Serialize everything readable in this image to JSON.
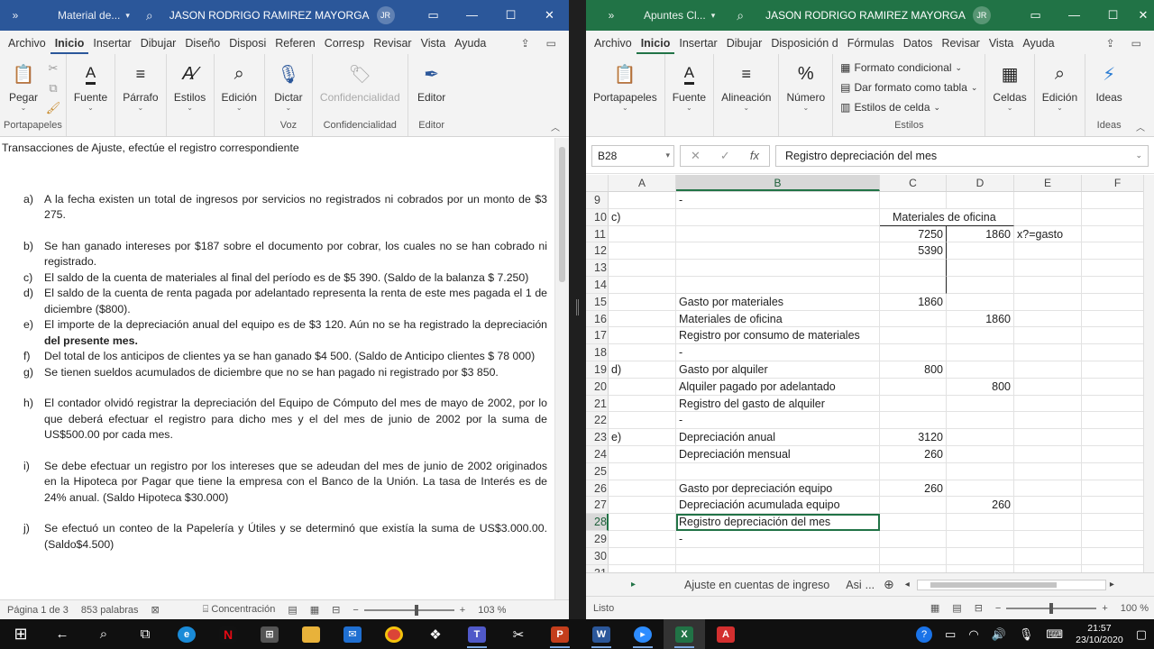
{
  "word": {
    "title_doc": "Material de...",
    "user": "JASON RODRIGO RAMIREZ MAYORGA",
    "initials": "JR",
    "tabs": [
      "Archivo",
      "Inicio",
      "Insertar",
      "Dibujar",
      "Diseño",
      "Disposi",
      "Referen",
      "Corresp",
      "Revisar",
      "Vista",
      "Ayuda"
    ],
    "ribbon": {
      "clipboard_group": "Portapapeles",
      "paste": "Pegar",
      "font": "Fuente",
      "paragraph": "Párrafo",
      "styles": "Estilos",
      "editing": "Edición",
      "dictate": "Dictar",
      "voice_group": "Voz",
      "confidentiality": "Confidencialidad",
      "confidentiality_group": "Confidencialidad",
      "editor": "Editor",
      "editor_group": "Editor"
    },
    "doc": {
      "heading": "Transacciones de Ajuste, efectúe el registro correspondiente",
      "items": [
        {
          "letter": "a)",
          "text": "A la fecha existen un total de ingresos por servicios no registrados ni cobrados por un monto de $3 275."
        },
        {
          "letter": "b)",
          "text": "Se han ganado intereses por $187 sobre el documento por cobrar, los cuales no se han cobrado ni registrado."
        },
        {
          "letter": "c)",
          "text": "El saldo de la cuenta de materiales al final del período es de $5 390. (Saldo de la balanza $ 7.250)"
        },
        {
          "letter": "d)",
          "text": "El saldo de la cuenta de renta pagada por adelantado representa la renta de este mes pagada el 1 de diciembre ($800)."
        },
        {
          "letter": "e)",
          "text_pre": "El importe de la depreciación anual del equipo es de $3 120. Aún no se ha registrado la depreciación ",
          "text_bold": "del presente mes."
        },
        {
          "letter": "f)",
          "text": "Del total de los anticipos de clientes ya se han ganado $4 500. (Saldo de Anticipo clientes $ 78 000)"
        },
        {
          "letter": "g)",
          "text": "Se tienen sueldos acumulados de diciembre que no se han pagado ni registrado por $3 850."
        },
        {
          "letter": "h)",
          "text": "El contador olvidó registrar la depreciación del Equipo de Cómputo del mes de mayo de 2002, por lo que deberá efectuar el registro para dicho mes y el del mes de junio de 2002 por la suma de US$500.00 por cada mes."
        },
        {
          "letter": "i)",
          "text": "Se debe efectuar un registro por los intereses que se adeudan del mes de junio de 2002 originados en la Hipoteca por Pagar que tiene la empresa con el Banco de la Unión. La tasa de Interés es de 24% anual. (Saldo Hipoteca $30.000)"
        },
        {
          "letter": "j)",
          "text": "Se efectuó un conteo de la Papelería y Útiles y se determinó que existía la suma de US$3.000.00. (Saldo$4.500)"
        }
      ]
    },
    "status": {
      "page": "Página 1 de 3",
      "words": "853 palabras",
      "focus": "Concentración",
      "zoom": "103 %"
    }
  },
  "excel": {
    "title_doc": "Apuntes Cl...",
    "user": "JASON RODRIGO RAMIREZ MAYORGA",
    "initials": "JR",
    "tabs": [
      "Archivo",
      "Inicio",
      "Insertar",
      "Dibujar",
      "Disposición d",
      "Fórmulas",
      "Datos",
      "Revisar",
      "Vista",
      "Ayuda"
    ],
    "ribbon": {
      "clipboard": "Portapapeles",
      "font": "Fuente",
      "alignment": "Alineación",
      "number": "Número",
      "conditional": "Formato condicional",
      "table_format": "Dar formato como tabla",
      "cell_styles": "Estilos de celda",
      "styles_group": "Estilos",
      "cells": "Celdas",
      "editing": "Edición",
      "ideas": "Ideas",
      "ideas_group": "Ideas"
    },
    "namebox": "B28",
    "formula": "Registro depreciación del mes",
    "columns": [
      "A",
      "B",
      "C",
      "D",
      "E",
      "F"
    ],
    "rows": [
      {
        "n": "9",
        "a": "",
        "b": "-",
        "c": "",
        "d": "",
        "e": ""
      },
      {
        "n": "10",
        "a": "c)",
        "b": "",
        "c": "Materiales de oficina",
        "d": "",
        "e": ""
      },
      {
        "n": "11",
        "a": "",
        "b": "",
        "c": "7250",
        "d": "1860",
        "e": "x?=gasto"
      },
      {
        "n": "12",
        "a": "",
        "b": "",
        "c": "5390",
        "d": "",
        "e": ""
      },
      {
        "n": "13",
        "a": "",
        "b": "",
        "c": "",
        "d": "",
        "e": ""
      },
      {
        "n": "14",
        "a": "",
        "b": "",
        "c": "",
        "d": "",
        "e": ""
      },
      {
        "n": "15",
        "a": "",
        "b": "Gasto por materiales",
        "c": "1860",
        "d": "",
        "e": ""
      },
      {
        "n": "16",
        "a": "",
        "b": "Materiales de oficina",
        "c": "",
        "d": "1860",
        "e": ""
      },
      {
        "n": "17",
        "a": "",
        "b": "Registro por consumo de materiales",
        "c": "",
        "d": "",
        "e": ""
      },
      {
        "n": "18",
        "a": "",
        "b": "-",
        "c": "",
        "d": "",
        "e": ""
      },
      {
        "n": "19",
        "a": "d)",
        "b": "Gasto por alquiler",
        "c": "800",
        "d": "",
        "e": ""
      },
      {
        "n": "20",
        "a": "",
        "b": "Alquiler pagado por adelantado",
        "c": "",
        "d": "800",
        "e": ""
      },
      {
        "n": "21",
        "a": "",
        "b": "Registro del gasto de alquiler",
        "c": "",
        "d": "",
        "e": ""
      },
      {
        "n": "22",
        "a": "",
        "b": "-",
        "c": "",
        "d": "",
        "e": ""
      },
      {
        "n": "23",
        "a": "e)",
        "b": "Depreciación anual",
        "c": "3120",
        "d": "",
        "e": ""
      },
      {
        "n": "24",
        "a": "",
        "b": "Depreciación mensual",
        "c": "260",
        "d": "",
        "e": ""
      },
      {
        "n": "25",
        "a": "",
        "b": "",
        "c": "",
        "d": "",
        "e": ""
      },
      {
        "n": "26",
        "a": "",
        "b": "Gasto por depreciación equipo",
        "c": "260",
        "d": "",
        "e": ""
      },
      {
        "n": "27",
        "a": "",
        "b": "Depreciación acumulada equipo",
        "c": "",
        "d": "260",
        "e": ""
      },
      {
        "n": "28",
        "a": "",
        "b": "Registro depreciación del mes",
        "c": "",
        "d": "",
        "e": ""
      },
      {
        "n": "29",
        "a": "",
        "b": "-",
        "c": "",
        "d": "",
        "e": ""
      },
      {
        "n": "30",
        "a": "",
        "b": "",
        "c": "",
        "d": "",
        "e": ""
      },
      {
        "n": "31",
        "a": "",
        "b": "",
        "c": "",
        "d": "",
        "e": ""
      }
    ],
    "sheet_tab": "Ajuste en cuentas de ingreso",
    "sheet_tab2": "Asi",
    "sheet_more": "...",
    "status_ready": "Listo",
    "zoom": "100 %"
  },
  "taskbar": {
    "time": "21:57",
    "date": "23/10/2020"
  },
  "colors": {
    "word_blue": "#2b579a",
    "excel_green": "#217346"
  }
}
